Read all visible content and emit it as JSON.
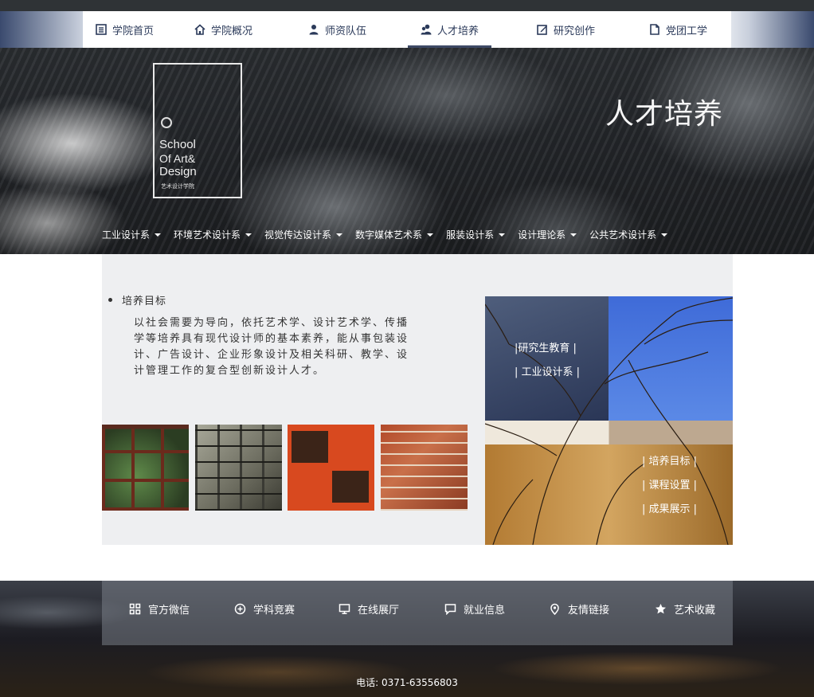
{
  "nav": {
    "items": [
      {
        "label": "学院首页",
        "icon": "list-icon"
      },
      {
        "label": "学院概况",
        "icon": "home-icon"
      },
      {
        "label": "师资队伍",
        "icon": "user-icon"
      },
      {
        "label": "人才培养",
        "icon": "users-icon",
        "active": true
      },
      {
        "label": "研究创作",
        "icon": "edit-icon"
      },
      {
        "label": "党团工学",
        "icon": "document-icon"
      }
    ]
  },
  "hero": {
    "logo_lines": [
      "School",
      "Of Art&",
      "Design"
    ],
    "logo_sub": "艺术设计学院",
    "title": "人才培养"
  },
  "departments": [
    "工业设计系",
    "环境艺术设计系",
    "视觉传达设计系",
    "数字媒体艺术系",
    "服装设计系",
    "设计理论系",
    "公共艺术设计系"
  ],
  "content": {
    "goal_heading": "培养目标",
    "goal_text": "以社会需要为导向，依托艺术学、设计艺术学、传播学等培养具有现代设计师的基本素养，能从事包装设计、广告设计、企业形象设计及相关科研、教学、设计管理工作的复合型创新设计人才。"
  },
  "panel": {
    "top_links": [
      "|研究生教育 |",
      "| 工业设计系 |"
    ],
    "bottom_links": [
      "| 培养目标 |",
      "| 课程设置 |",
      "| 成果展示 |"
    ]
  },
  "footer": {
    "items": [
      {
        "label": "官方微信",
        "icon": "grid-icon"
      },
      {
        "label": "学科竞赛",
        "icon": "plus-circle-icon"
      },
      {
        "label": "在线展厅",
        "icon": "monitor-icon"
      },
      {
        "label": "就业信息",
        "icon": "chat-icon"
      },
      {
        "label": "友情链接",
        "icon": "location-pin-icon"
      },
      {
        "label": "艺术收藏",
        "icon": "star-icon"
      }
    ],
    "phone": "电话: 0371-63556803"
  }
}
